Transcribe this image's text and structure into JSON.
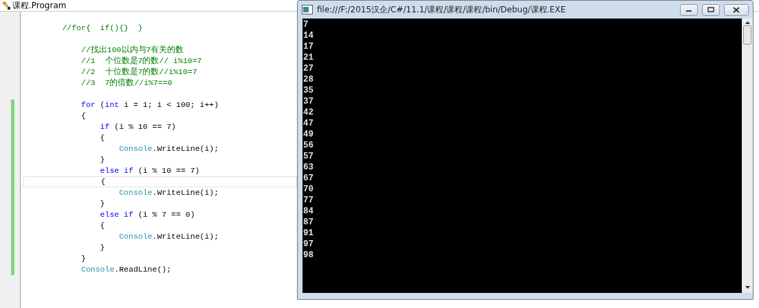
{
  "editor": {
    "title": "课程.Program",
    "lines": [
      {
        "kind": "code",
        "changed": false,
        "current": false,
        "segments": [
          {
            "kind": "comment",
            "text": "        //for{  if(){}  }"
          }
        ]
      },
      {
        "kind": "blank"
      },
      {
        "kind": "code",
        "changed": false,
        "current": false,
        "segments": [
          {
            "kind": "comment",
            "text": "            //找出100以内与7有关的数"
          }
        ]
      },
      {
        "kind": "code",
        "changed": false,
        "current": false,
        "segments": [
          {
            "kind": "comment",
            "text": "            //1  个位数是7的数// i%10=7"
          }
        ]
      },
      {
        "kind": "code",
        "changed": false,
        "current": false,
        "segments": [
          {
            "kind": "comment",
            "text": "            //2  十位数是7的数//i%10=7"
          }
        ]
      },
      {
        "kind": "code",
        "changed": false,
        "current": false,
        "segments": [
          {
            "kind": "comment",
            "text": "            //3  7的倍数//i%7==0"
          }
        ]
      },
      {
        "kind": "blank"
      },
      {
        "kind": "code",
        "changed": true,
        "current": false,
        "segments": [
          {
            "kind": "keyword",
            "text": "            for"
          },
          {
            "kind": "plain",
            "text": " ("
          },
          {
            "kind": "keyword",
            "text": "int"
          },
          {
            "kind": "plain",
            "text": " i = 1; i < 100; i++)"
          }
        ]
      },
      {
        "kind": "code",
        "changed": true,
        "current": false,
        "segments": [
          {
            "kind": "plain",
            "text": "            {"
          }
        ]
      },
      {
        "kind": "code",
        "changed": true,
        "current": false,
        "segments": [
          {
            "kind": "keyword",
            "text": "                if"
          },
          {
            "kind": "plain",
            "text": " (i % 10 == 7)"
          }
        ]
      },
      {
        "kind": "code",
        "changed": true,
        "current": false,
        "segments": [
          {
            "kind": "plain",
            "text": "                {"
          }
        ]
      },
      {
        "kind": "code",
        "changed": true,
        "current": false,
        "segments": [
          {
            "kind": "type",
            "text": "                    Console"
          },
          {
            "kind": "plain",
            "text": ".WriteLine(i);"
          }
        ]
      },
      {
        "kind": "code",
        "changed": true,
        "current": false,
        "segments": [
          {
            "kind": "plain",
            "text": "                }"
          }
        ]
      },
      {
        "kind": "code",
        "changed": true,
        "current": false,
        "segments": [
          {
            "kind": "keyword",
            "text": "                else if"
          },
          {
            "kind": "plain",
            "text": " (i % 10 == 7)"
          }
        ]
      },
      {
        "kind": "code",
        "changed": true,
        "current": true,
        "segments": [
          {
            "kind": "plain",
            "text": "                {"
          }
        ]
      },
      {
        "kind": "code",
        "changed": true,
        "current": false,
        "segments": [
          {
            "kind": "type",
            "text": "                    Console"
          },
          {
            "kind": "plain",
            "text": ".WriteLine(i);"
          }
        ]
      },
      {
        "kind": "code",
        "changed": true,
        "current": false,
        "segments": [
          {
            "kind": "plain",
            "text": "                }"
          }
        ]
      },
      {
        "kind": "code",
        "changed": true,
        "current": false,
        "segments": [
          {
            "kind": "keyword",
            "text": "                else if"
          },
          {
            "kind": "plain",
            "text": " (i % 7 == 0)"
          }
        ]
      },
      {
        "kind": "code",
        "changed": true,
        "current": false,
        "segments": [
          {
            "kind": "plain",
            "text": "                {"
          }
        ]
      },
      {
        "kind": "code",
        "changed": true,
        "current": false,
        "segments": [
          {
            "kind": "type",
            "text": "                    Console"
          },
          {
            "kind": "plain",
            "text": ".WriteLine(i);"
          }
        ]
      },
      {
        "kind": "code",
        "changed": true,
        "current": false,
        "segments": [
          {
            "kind": "plain",
            "text": "                }"
          }
        ]
      },
      {
        "kind": "code",
        "changed": true,
        "current": false,
        "segments": [
          {
            "kind": "plain",
            "text": "            }"
          }
        ]
      },
      {
        "kind": "code",
        "changed": true,
        "current": false,
        "segments": [
          {
            "kind": "type",
            "text": "            Console"
          },
          {
            "kind": "plain",
            "text": ".ReadLine();"
          }
        ]
      }
    ]
  },
  "console": {
    "title": "file:///F:/2015汉企/C#/11.1/课程/课程/课程/bin/Debug/课程.EXE",
    "output": [
      "7",
      "14",
      "17",
      "21",
      "27",
      "28",
      "35",
      "37",
      "42",
      "47",
      "49",
      "56",
      "57",
      "63",
      "67",
      "70",
      "77",
      "84",
      "87",
      "91",
      "97",
      "98"
    ]
  }
}
